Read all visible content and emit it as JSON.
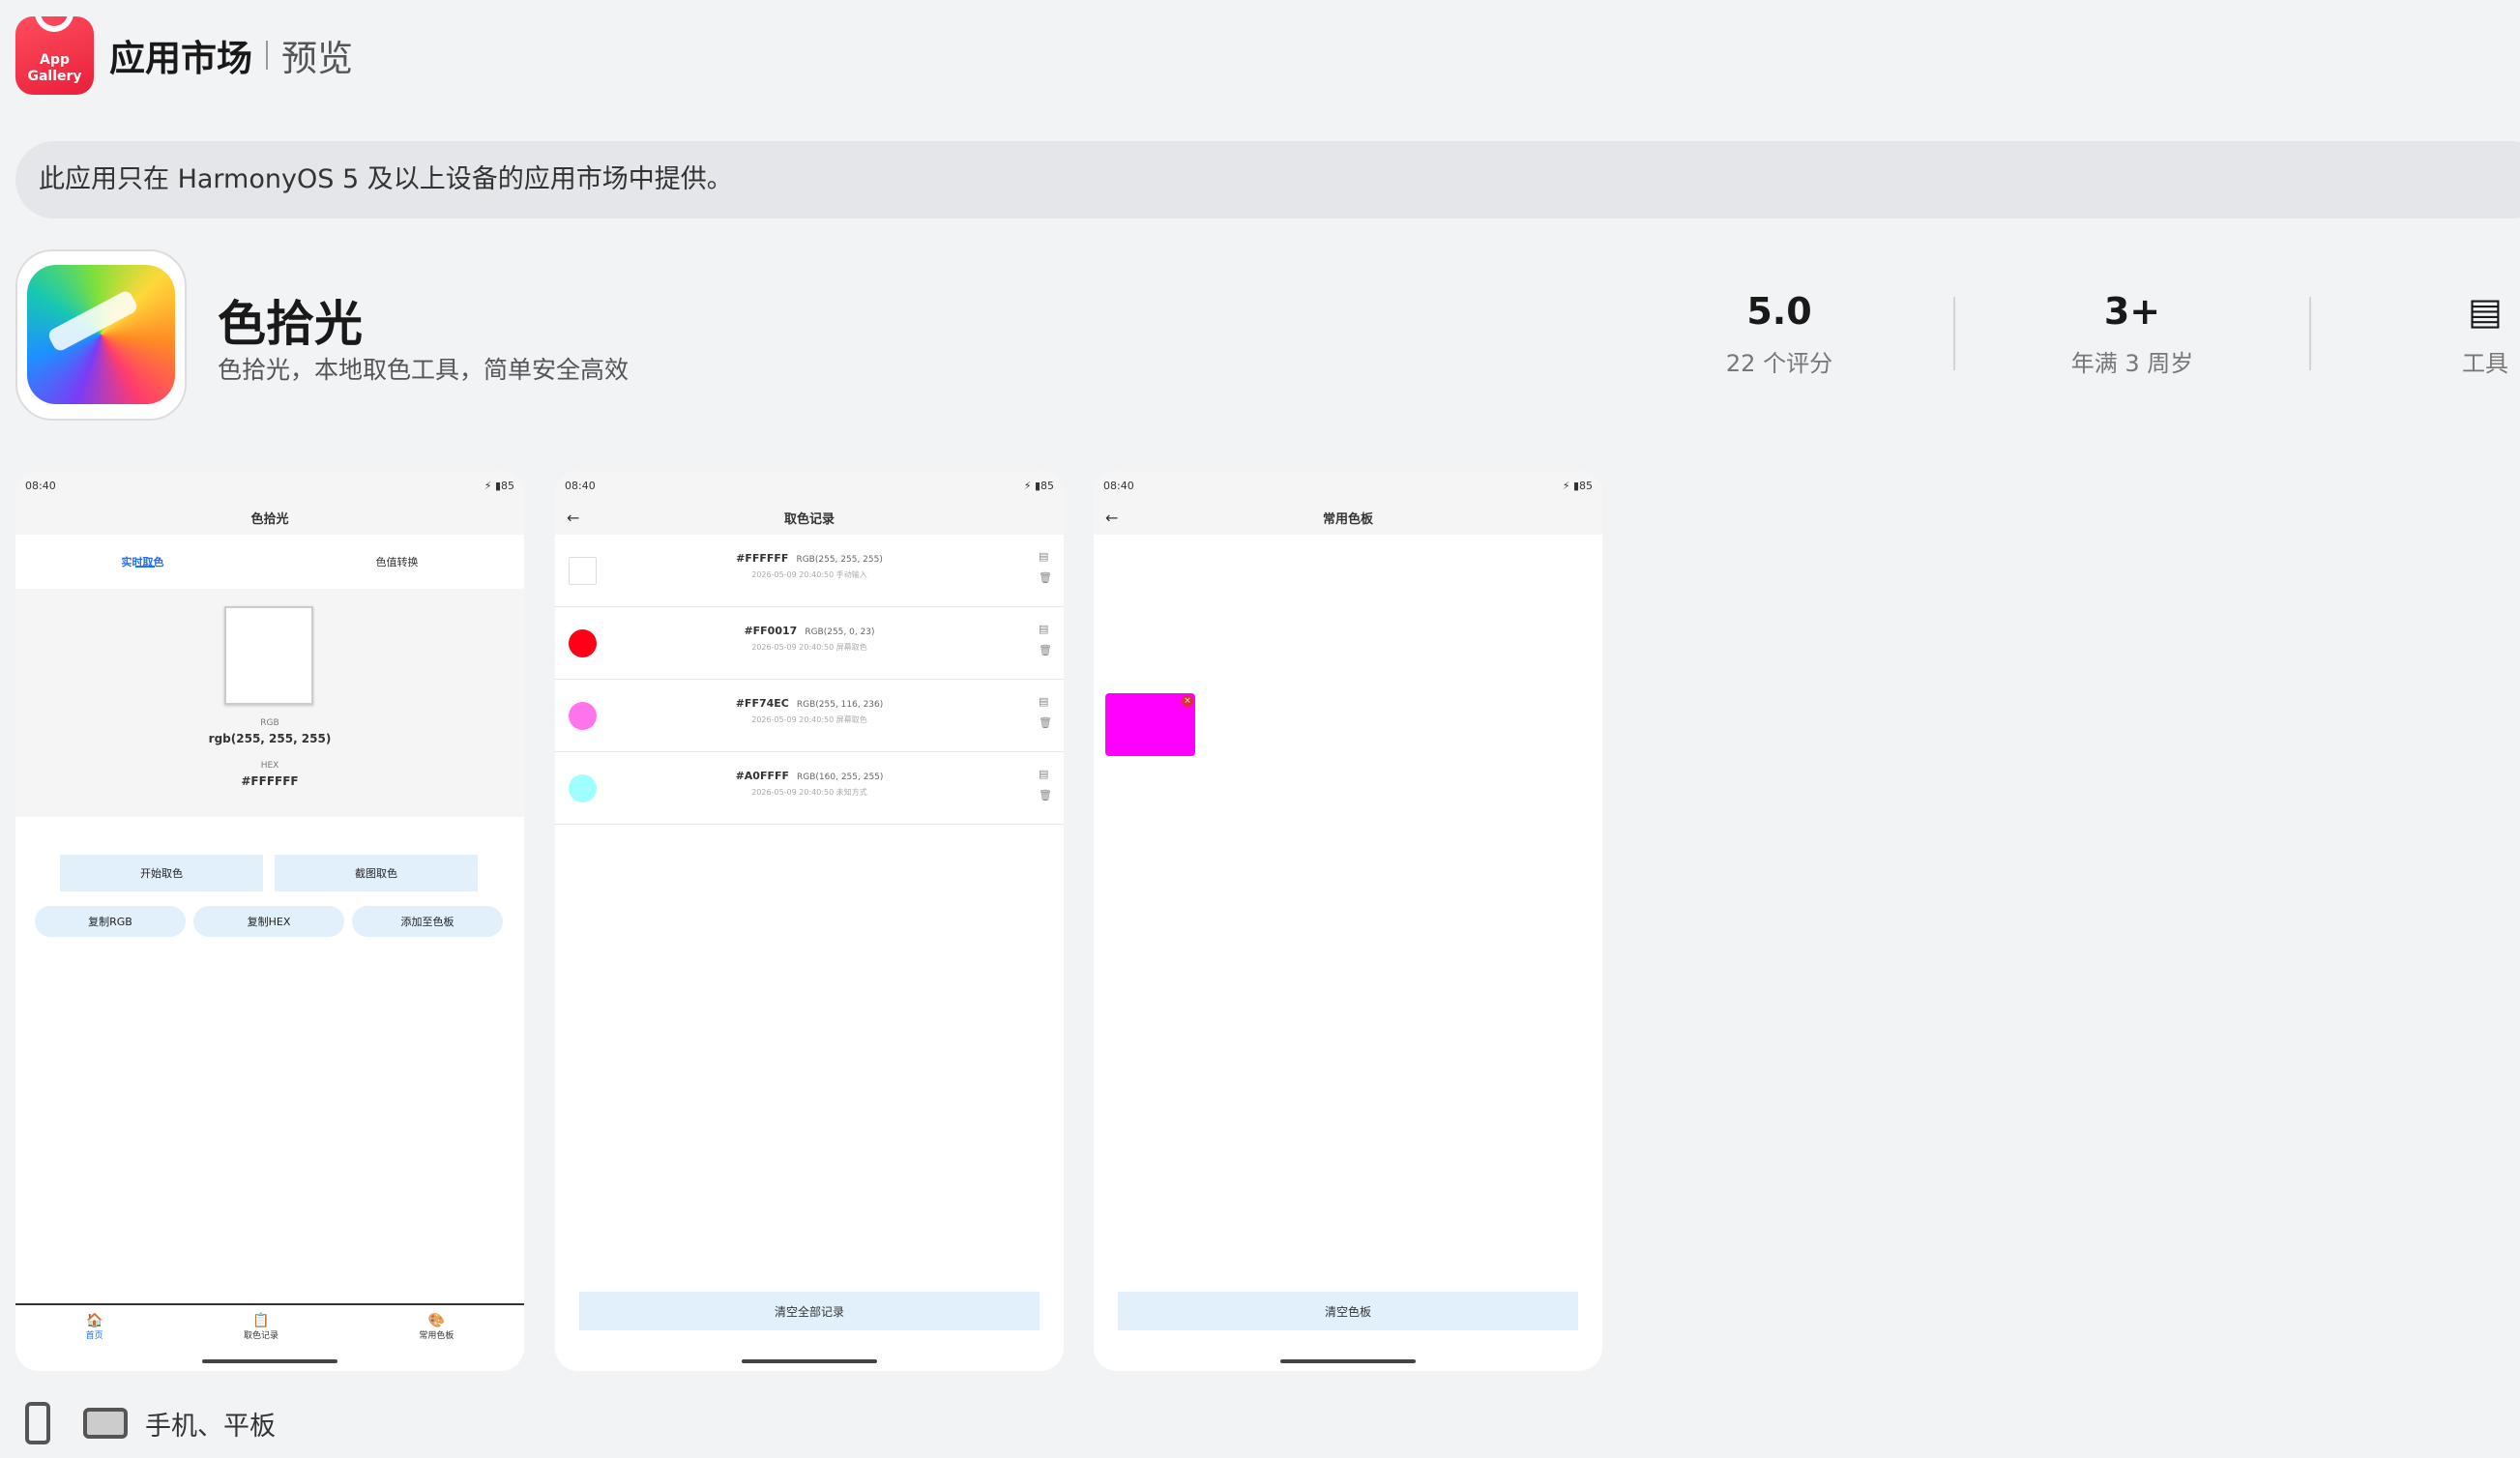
{
  "header": {
    "logo_text": "App Gallery",
    "title": "应用市场",
    "sub": "预览"
  },
  "notice": "此应用只在 HarmonyOS 5 及以上设备的应用市场中提供。",
  "app": {
    "name": "色拾光",
    "desc": "色拾光，本地取色工具，简单安全高效"
  },
  "stats": [
    {
      "v": "5.0",
      "l": "22 个评分"
    },
    {
      "v": "3+",
      "l": "年满 3 周岁"
    },
    {
      "l": "工具"
    }
  ],
  "status": {
    "time": "08:40",
    "batt": "85"
  },
  "s1": {
    "title": "色拾光",
    "tab1": "实时取色",
    "tab2": "色值转换",
    "k1": "RGB",
    "v1": "rgb(255, 255, 255)",
    "k2": "HEX",
    "v2": "#FFFFFF",
    "b1": "开始取色",
    "b2": "截图取色",
    "b3": "复制RGB",
    "b4": "复制HEX",
    "b5": "添加至色板",
    "nav": [
      "首页",
      "取色记录",
      "常用色板"
    ]
  },
  "s2": {
    "title": "取色记录",
    "records": [
      {
        "hex": "#FFFFFF",
        "rgb": "RGB(255, 255, 255)",
        "time": "2026-05-09 20:40:50   手动输入",
        "color": "#ffffff"
      },
      {
        "hex": "#FF0017",
        "rgb": "RGB(255, 0, 23)",
        "time": "2026-05-09 20:40:50   屏幕取色",
        "color": "#ff0017"
      },
      {
        "hex": "#FF74EC",
        "rgb": "RGB(255, 116, 236)",
        "time": "2026-05-09 20:40:50   屏幕取色",
        "color": "#ff74ec"
      },
      {
        "hex": "#A0FFFF",
        "rgb": "RGB(160, 255, 255)",
        "time": "2026-05-09 20:40:50   未知方式",
        "color": "#a0ffff"
      }
    ],
    "clear": "清空全部记录"
  },
  "s3": {
    "title": "常用色板",
    "swatch": "#FF00FF",
    "clear": "清空色板"
  },
  "footer": "手机、平板"
}
